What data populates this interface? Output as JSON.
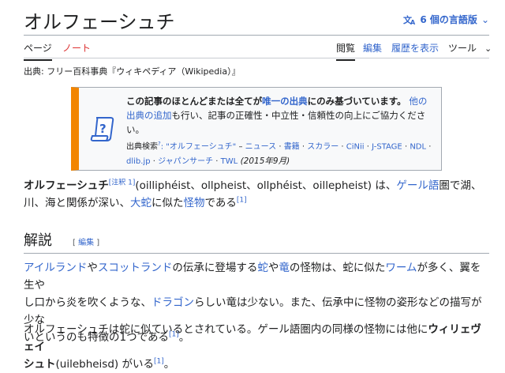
{
  "header": {
    "title": "オルフェーシュチ",
    "lang_icon": "translate-icon",
    "lang_label": "6 個の言語版",
    "lang_chevron": "chevron-down-icon"
  },
  "tabs": {
    "page": "ページ",
    "note": "ノート",
    "read": "閲覧",
    "edit": "編集",
    "history": "履歴を表示",
    "tools": "ツール"
  },
  "source_line": "出典: フリー百科事典『ウィキペディア（Wikipedia）』",
  "ambox": {
    "icon": "scroll-question-icon",
    "l1_bold_a": "この記事のほとんどまたは全てが",
    "l1_link": "唯一の出典",
    "l1_bold_b": "にのみ基づいています。",
    "l1_link2": "他の",
    "l2_link": "出典の追加",
    "l2_text": "も行い、記事の正確性・中立性・信頼性の向上にご協力くださ",
    "l3_text": "い。",
    "search_label": "出典検索",
    "search_q": "?",
    "search_term": ": \"オルフェーシュチ\"",
    "sep1": " – ",
    "news": "ニュース",
    "dot": " · ",
    "books": "書籍",
    "scholar": "スカラー",
    "cinii": "CiNii",
    "jstage": "J-STAGE",
    "ndl": "NDL",
    "dlib": "dlib.jp",
    "japansearch": "ジャパンサーチ",
    "twl": "TWL",
    "date": " (2015年9月)"
  },
  "p1": {
    "bold": "オルフェーシュチ",
    "note_ref": "[注釈 1]",
    "t1": "(oilliphéist、ollpheist、ollphéist、oillepheist) は、",
    "gaelic": "ゲール語",
    "t2": "圏で湖、",
    "t3": "川、海と関係が深い、",
    "daija": "大蛇",
    "t4": "に似た",
    "monster": "怪物",
    "t5": "である",
    "ref": "[1]"
  },
  "section": {
    "title": "解説",
    "edit_open": "[",
    "edit_link": "編集",
    "edit_close": "]"
  },
  "p2": {
    "ireland": "アイルランド",
    "ya1": "や",
    "scotland": "スコットランド",
    "t1": "の伝承に登場する",
    "hebi": "蛇",
    "ya2": "や",
    "ryu": "竜",
    "t2": "の怪物は、蛇に似た",
    "worm": "ワーム",
    "t3": "が多く、翼を生や",
    "t4": "し口から炎を吹くような、",
    "dragon": "ドラゴン",
    "t5": "らしい竜は少ない。また、伝承中に怪物の姿形などの描写が少な",
    "t6": "いというのも特徴の1つである",
    "ref": "[1]",
    "t7": "。"
  },
  "p3": {
    "t1": "オルフェーシュチは蛇に似ているとされている。ゲール語圏内の同様の怪物には他に",
    "bold1": "ウィリェヴェイ",
    "bold2": "シュト",
    "t2": "(uilebheisd) がいる",
    "ref": "[1]",
    "t3": "。"
  }
}
